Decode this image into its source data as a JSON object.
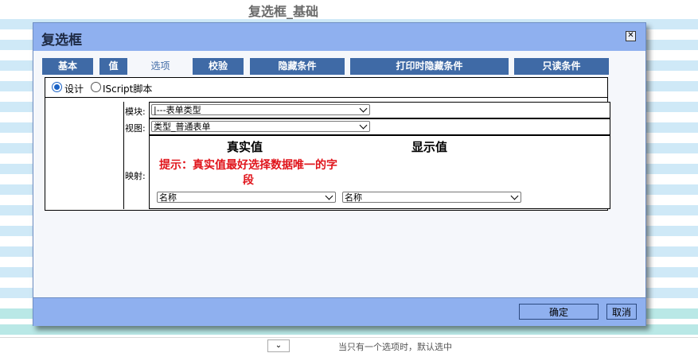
{
  "background": {
    "title": "复选框_基础",
    "hint": "当只有一个选项时，默认选中"
  },
  "dialog": {
    "title": "复选框",
    "tabs": [
      {
        "label": "基本"
      },
      {
        "label": "值"
      },
      {
        "label": "选项"
      },
      {
        "label": "校验"
      },
      {
        "label": "隐藏条件"
      },
      {
        "label": "打印时隐藏条件"
      },
      {
        "label": "只读条件"
      }
    ],
    "active_tab": "选项",
    "mode": {
      "design_label": "设计",
      "script_label": "IScript脚本",
      "selected": "设计"
    },
    "module": {
      "label": "模块:",
      "value": "|---表单类型"
    },
    "view": {
      "label": "视图:",
      "value": "类型_普通表单"
    },
    "mapping": {
      "label": "映射:",
      "real_value_header": "真实值",
      "display_value_header": "显示值",
      "tip": "提示：真实值最好选择数据唯一的字段",
      "real_value_select": "名称",
      "display_value_select": "名称"
    },
    "footer": {
      "ok_label": "确定",
      "cancel_label": "取消"
    },
    "colors": {
      "header": "#8fb0ef",
      "tab": "#3f6aa6",
      "tip": "#e0141b"
    }
  }
}
